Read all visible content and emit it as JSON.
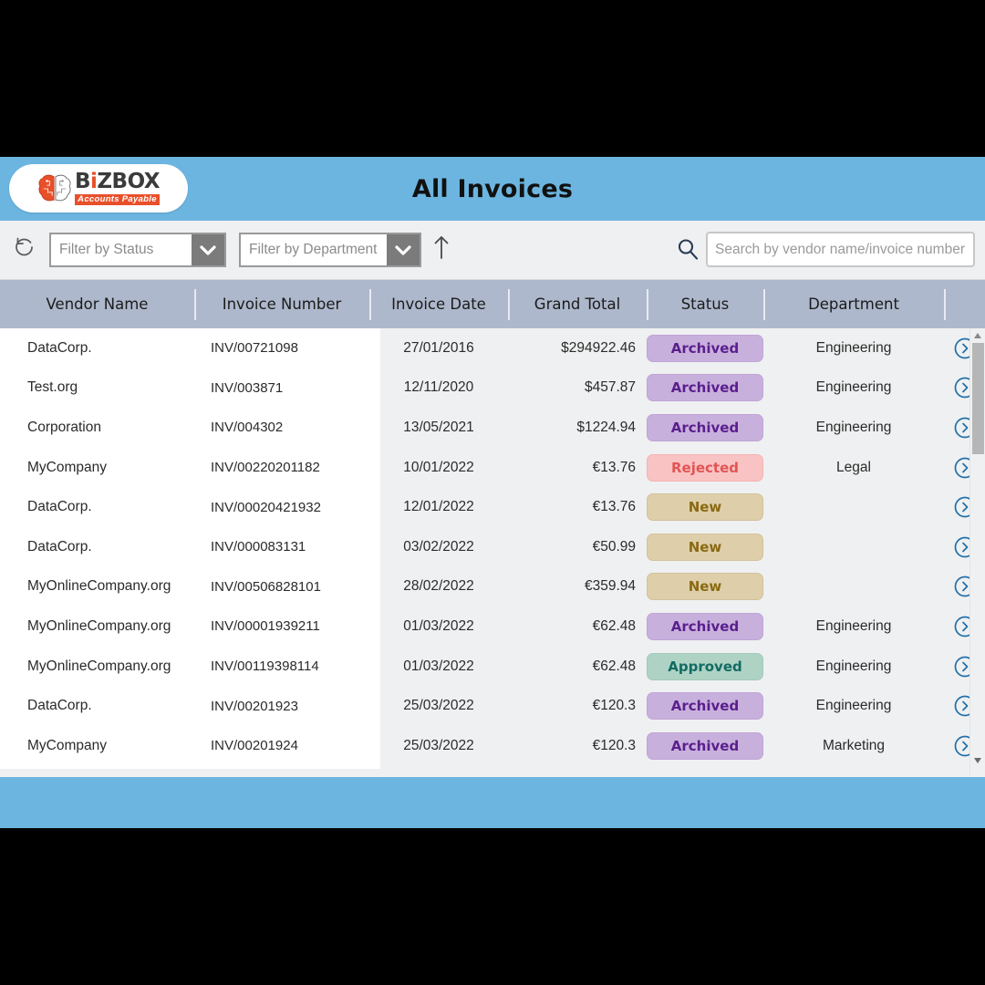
{
  "header": {
    "title": "All Invoices",
    "logo": {
      "word_part1": "B",
      "word_i": "i",
      "word_part2": "ZBOX",
      "subtitle": "Accounts Payable",
      "icon": "brain-icon"
    },
    "bg_color": "#6cb5e0"
  },
  "toolbar": {
    "refresh_icon": "refresh-icon",
    "sort_icon": "sort-ascending-icon",
    "search_icon": "search-icon",
    "status_filter": {
      "placeholder": "Filter by Status",
      "value": "",
      "chevron": "chevron-down-icon"
    },
    "department_filter": {
      "placeholder": "Filter by Department",
      "value": "",
      "chevron": "chevron-down-icon"
    },
    "search": {
      "placeholder": "Search by vendor name/invoice number",
      "value": ""
    }
  },
  "table": {
    "columns": [
      "Vendor Name",
      "Invoice Number",
      "Invoice Date",
      "Grand Total",
      "Status",
      "Department"
    ],
    "header_bg": "#aeb8cc",
    "rows": [
      {
        "vendor": "DataCorp.",
        "invoice_number": "INV/00721098",
        "invoice_date": "27/01/2016",
        "grand_total": "$294922.46",
        "status": "Archived",
        "department": "Engineering",
        "action_icon": "chevron-right-circle-icon"
      },
      {
        "vendor": "Test.org",
        "invoice_number": "INV/003871",
        "invoice_date": "12/11/2020",
        "grand_total": "$457.87",
        "status": "Archived",
        "department": "Engineering",
        "action_icon": "chevron-right-circle-icon"
      },
      {
        "vendor": "Corporation",
        "invoice_number": "INV/004302",
        "invoice_date": "13/05/2021",
        "grand_total": "$1224.94",
        "status": "Archived",
        "department": "Engineering",
        "action_icon": "chevron-right-circle-icon"
      },
      {
        "vendor": "MyCompany",
        "invoice_number": "INV/00220201182",
        "invoice_date": "10/01/2022",
        "grand_total": "€13.76",
        "status": "Rejected",
        "department": "Legal",
        "action_icon": "chevron-right-circle-icon"
      },
      {
        "vendor": "DataCorp.",
        "invoice_number": "INV/00020421932",
        "invoice_date": "12/01/2022",
        "grand_total": "€13.76",
        "status": "New",
        "department": "",
        "action_icon": "chevron-right-circle-icon"
      },
      {
        "vendor": "DataCorp.",
        "invoice_number": "INV/000083131",
        "invoice_date": "03/02/2022",
        "grand_total": "€50.99",
        "status": "New",
        "department": "",
        "action_icon": "chevron-right-circle-icon"
      },
      {
        "vendor": "MyOnlineCompany.org",
        "invoice_number": "INV/00506828101",
        "invoice_date": "28/02/2022",
        "grand_total": "€359.94",
        "status": "New",
        "department": "",
        "action_icon": "chevron-right-circle-icon"
      },
      {
        "vendor": "MyOnlineCompany.org",
        "invoice_number": "INV/00001939211",
        "invoice_date": "01/03/2022",
        "grand_total": "€62.48",
        "status": "Archived",
        "department": "Engineering",
        "action_icon": "chevron-right-circle-icon"
      },
      {
        "vendor": "MyOnlineCompany.org",
        "invoice_number": "INV/00119398114",
        "invoice_date": "01/03/2022",
        "grand_total": "€62.48",
        "status": "Approved",
        "department": "Engineering",
        "action_icon": "chevron-right-circle-icon"
      },
      {
        "vendor": "DataCorp.",
        "invoice_number": "INV/00201923",
        "invoice_date": "25/03/2022",
        "grand_total": "€120.3",
        "status": "Archived",
        "department": "Engineering",
        "action_icon": "chevron-right-circle-icon"
      },
      {
        "vendor": "MyCompany",
        "invoice_number": "INV/00201924",
        "invoice_date": "25/03/2022",
        "grand_total": "€120.3",
        "status": "Archived",
        "department": "Marketing",
        "action_icon": "chevron-right-circle-icon"
      }
    ]
  },
  "scrollbar": {
    "up_icon": "triangle-up-icon",
    "down_icon": "triangle-down-icon",
    "thumb": "scrollbar-thumb"
  },
  "status_colors": {
    "Archived": "#c8b0dd",
    "Rejected": "#f9c3c3",
    "New": "#decfaa",
    "Approved": "#aed3c5"
  }
}
